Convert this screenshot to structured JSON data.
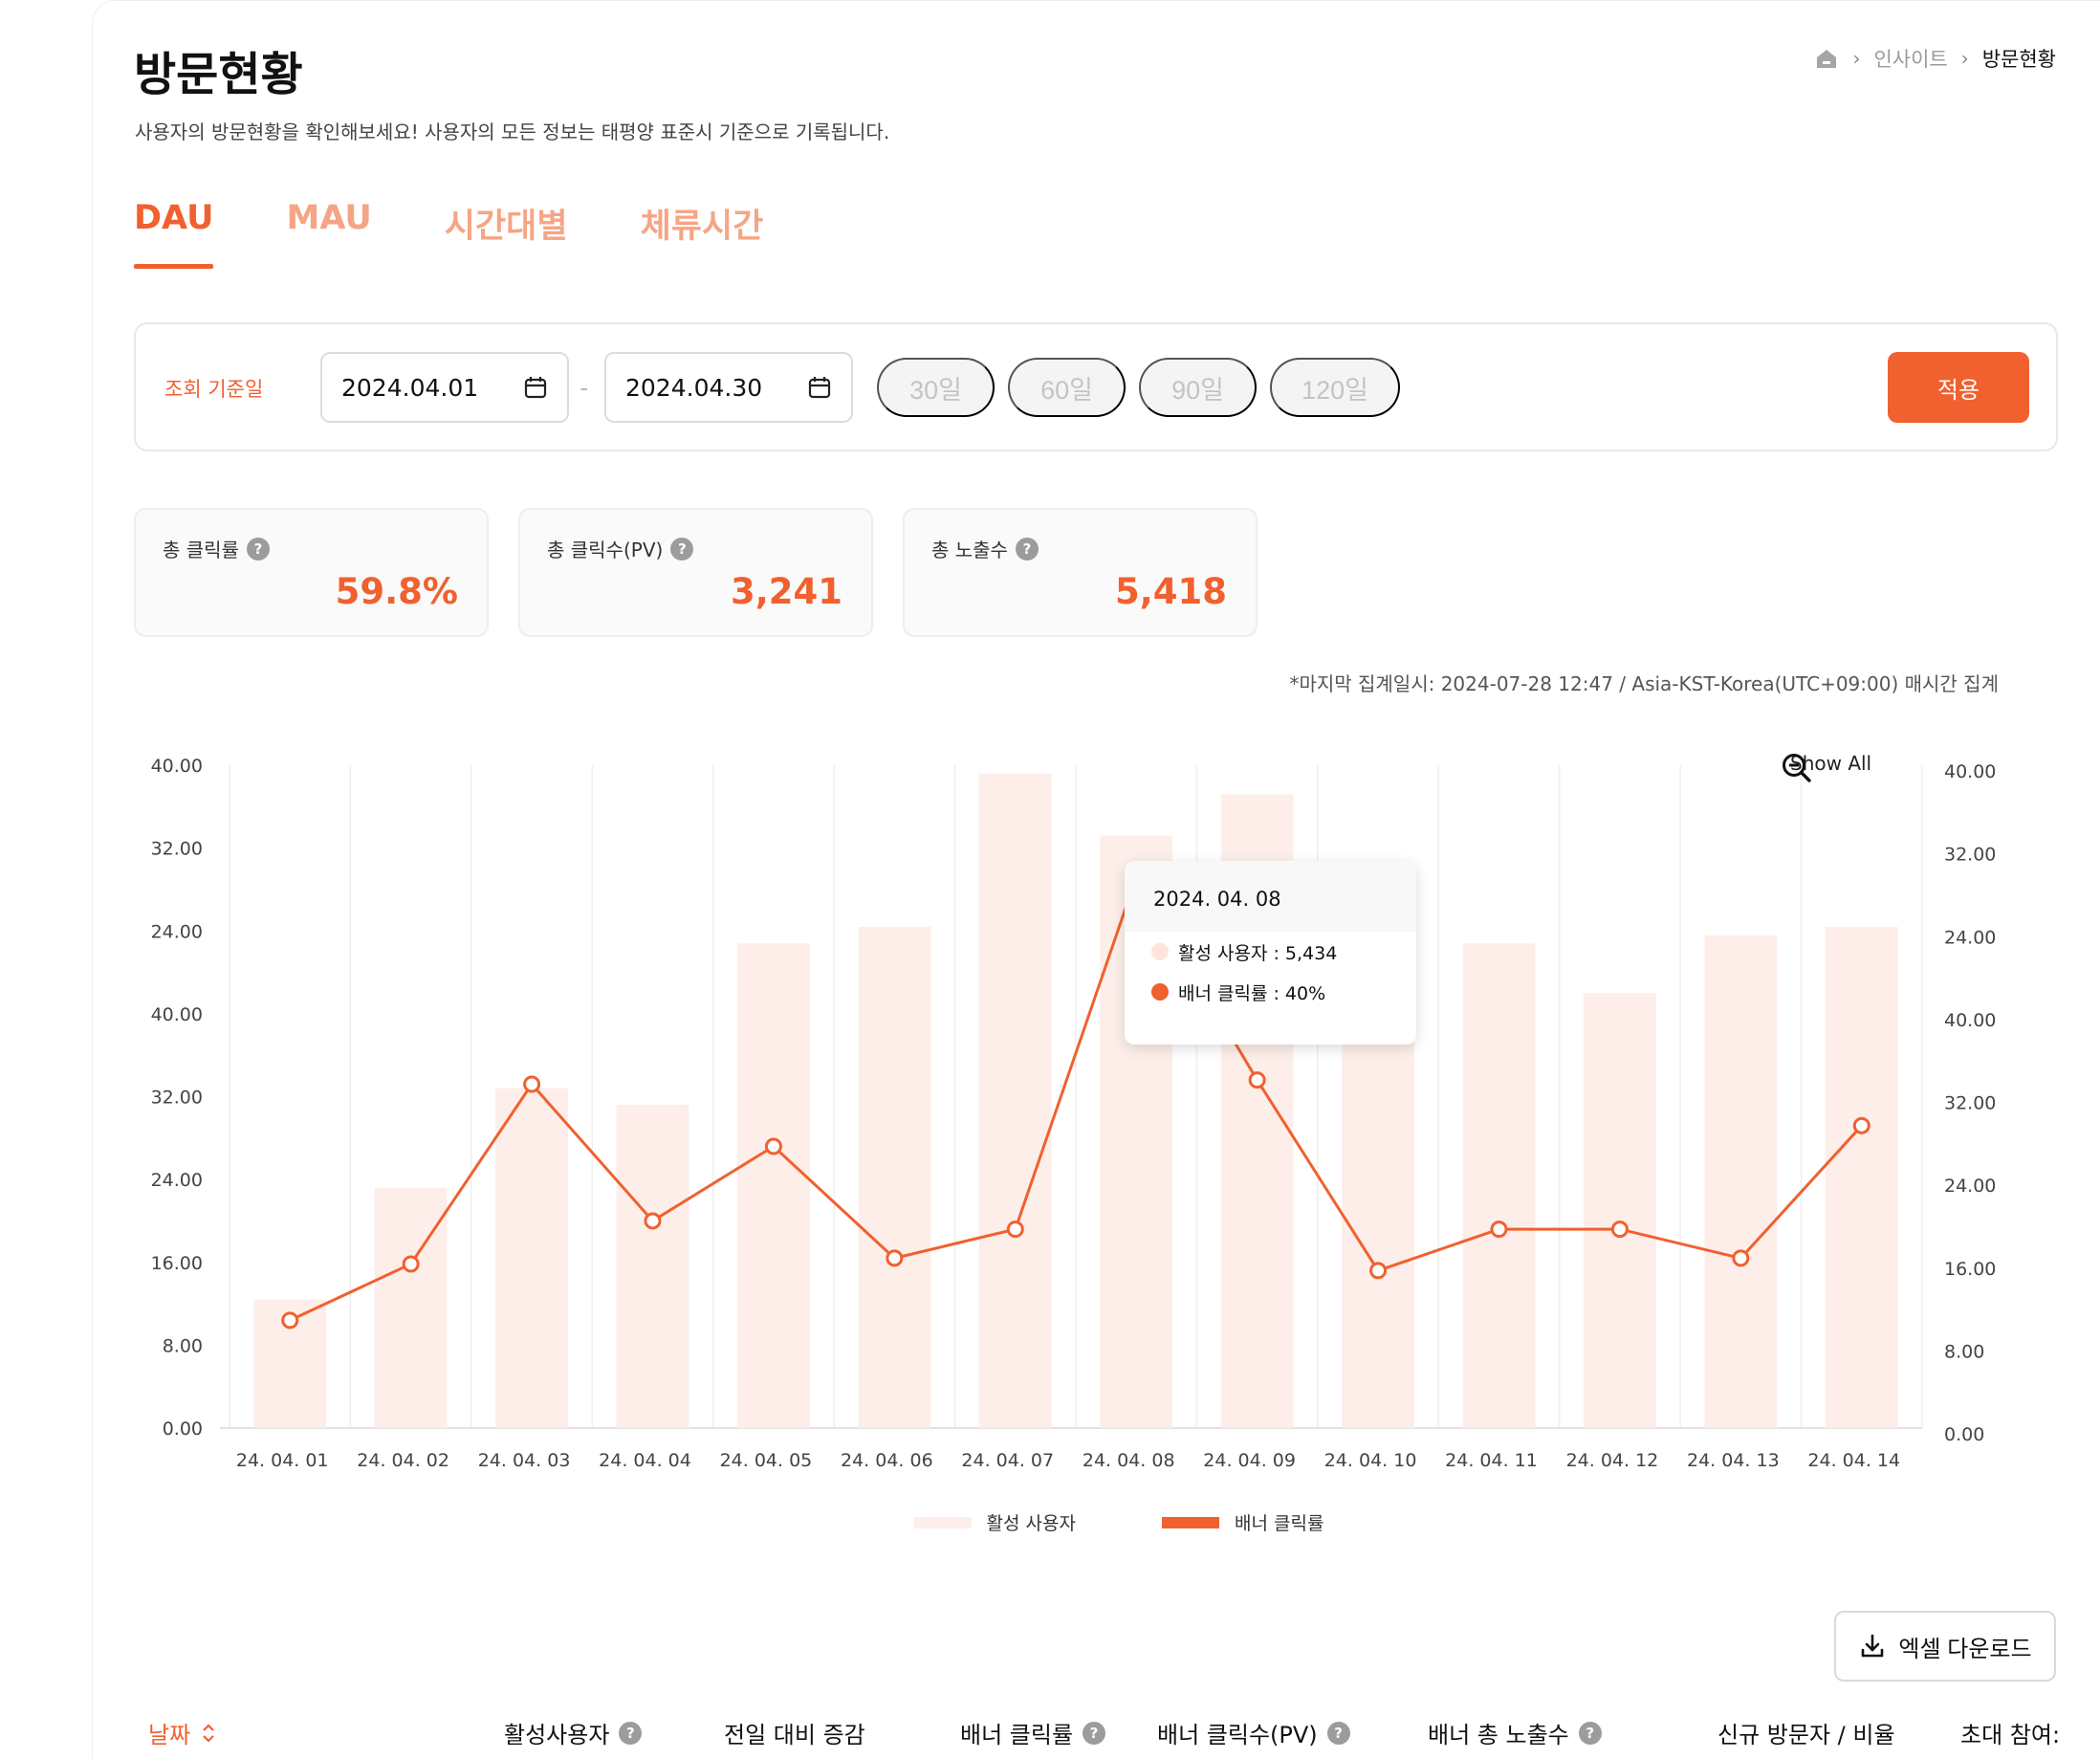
{
  "header": {
    "title": "방문현황",
    "subtitle": "사용자의 방문현황을 확인해보세요! 사용자의 모든 정보는 태평양 표준시 기준으로 기록됩니다.",
    "breadcrumb": [
      "인사이트",
      "방문현황"
    ]
  },
  "tabs": [
    {
      "label": "DAU",
      "active": true
    },
    {
      "label": "MAU",
      "active": false
    },
    {
      "label": "시간대별",
      "active": false
    },
    {
      "label": "체류시간",
      "active": false
    }
  ],
  "filter": {
    "label": "조회 기준일",
    "start_date": "2024.04.01",
    "end_date": "2024.04.30",
    "presets": [
      "30일",
      "60일",
      "90일",
      "120일"
    ],
    "apply_label": "적용"
  },
  "stats": [
    {
      "label": "총 클릭률",
      "value": "59.8%"
    },
    {
      "label": "총 클릭수(PV)",
      "value": "3,241"
    },
    {
      "label": "총 노출수",
      "value": "5,418"
    }
  ],
  "aggregation_note": "*마지막 집계일시: 2024-07-28 12:47 / Asia-KST-Korea(UTC+09:00) 매시간 집계",
  "show_all_label": "Show All",
  "tooltip": {
    "date": "2024. 04. 08",
    "active_users": "활성 사용자 : 5,434",
    "banner_ctr": "배너 클릭률 : 40%"
  },
  "colors": {
    "accent": "#f1602f",
    "bar": "#fdeee9",
    "tab_inactive": "#f5a585"
  },
  "chart_data": {
    "type": "bar",
    "categories": [
      "24. 04. 01",
      "24. 04. 02",
      "24. 04. 03",
      "24. 04. 04",
      "24. 04. 05",
      "24. 04. 06",
      "24. 04. 07",
      "24. 04. 08",
      "24. 04. 09",
      "24. 04. 10",
      "24. 04. 11",
      "24. 04. 12",
      "24. 04. 13",
      "24. 04. 14"
    ],
    "left_ticks": [
      "0.00",
      "8.00",
      "16.00",
      "24.00",
      "32.00",
      "40.00",
      "24.00",
      "32.00",
      "40.00"
    ],
    "right_ticks": [
      "0.00",
      "8.00",
      "16.00",
      "24.00",
      "32.00",
      "40.00",
      "24.00",
      "32.00",
      "40.00"
    ],
    "series": [
      {
        "name": "활성 사용자",
        "kind": "bar",
        "values": [
          15.5,
          29,
          41,
          39,
          58.5,
          60.5,
          79,
          71.5,
          76.5,
          60.5,
          58.5,
          52.5,
          59.5,
          60.5
        ]
      },
      {
        "name": "배너 클릭률",
        "kind": "line",
        "values": [
          13,
          19.8,
          41.5,
          25,
          34,
          20.5,
          24,
          66.5,
          42,
          19,
          24,
          24,
          20.5,
          36.5
        ]
      }
    ],
    "legend_position": "bottom"
  },
  "excel_label": "엑셀 다운로드",
  "table": {
    "headers": [
      "날짜",
      "활성사용자",
      "전일 대비 증감",
      "배너 클릭률",
      "배너 클릭수(PV)",
      "배너 총 노출수",
      "신규 방문자 / 비율",
      "초대 참여:"
    ]
  }
}
